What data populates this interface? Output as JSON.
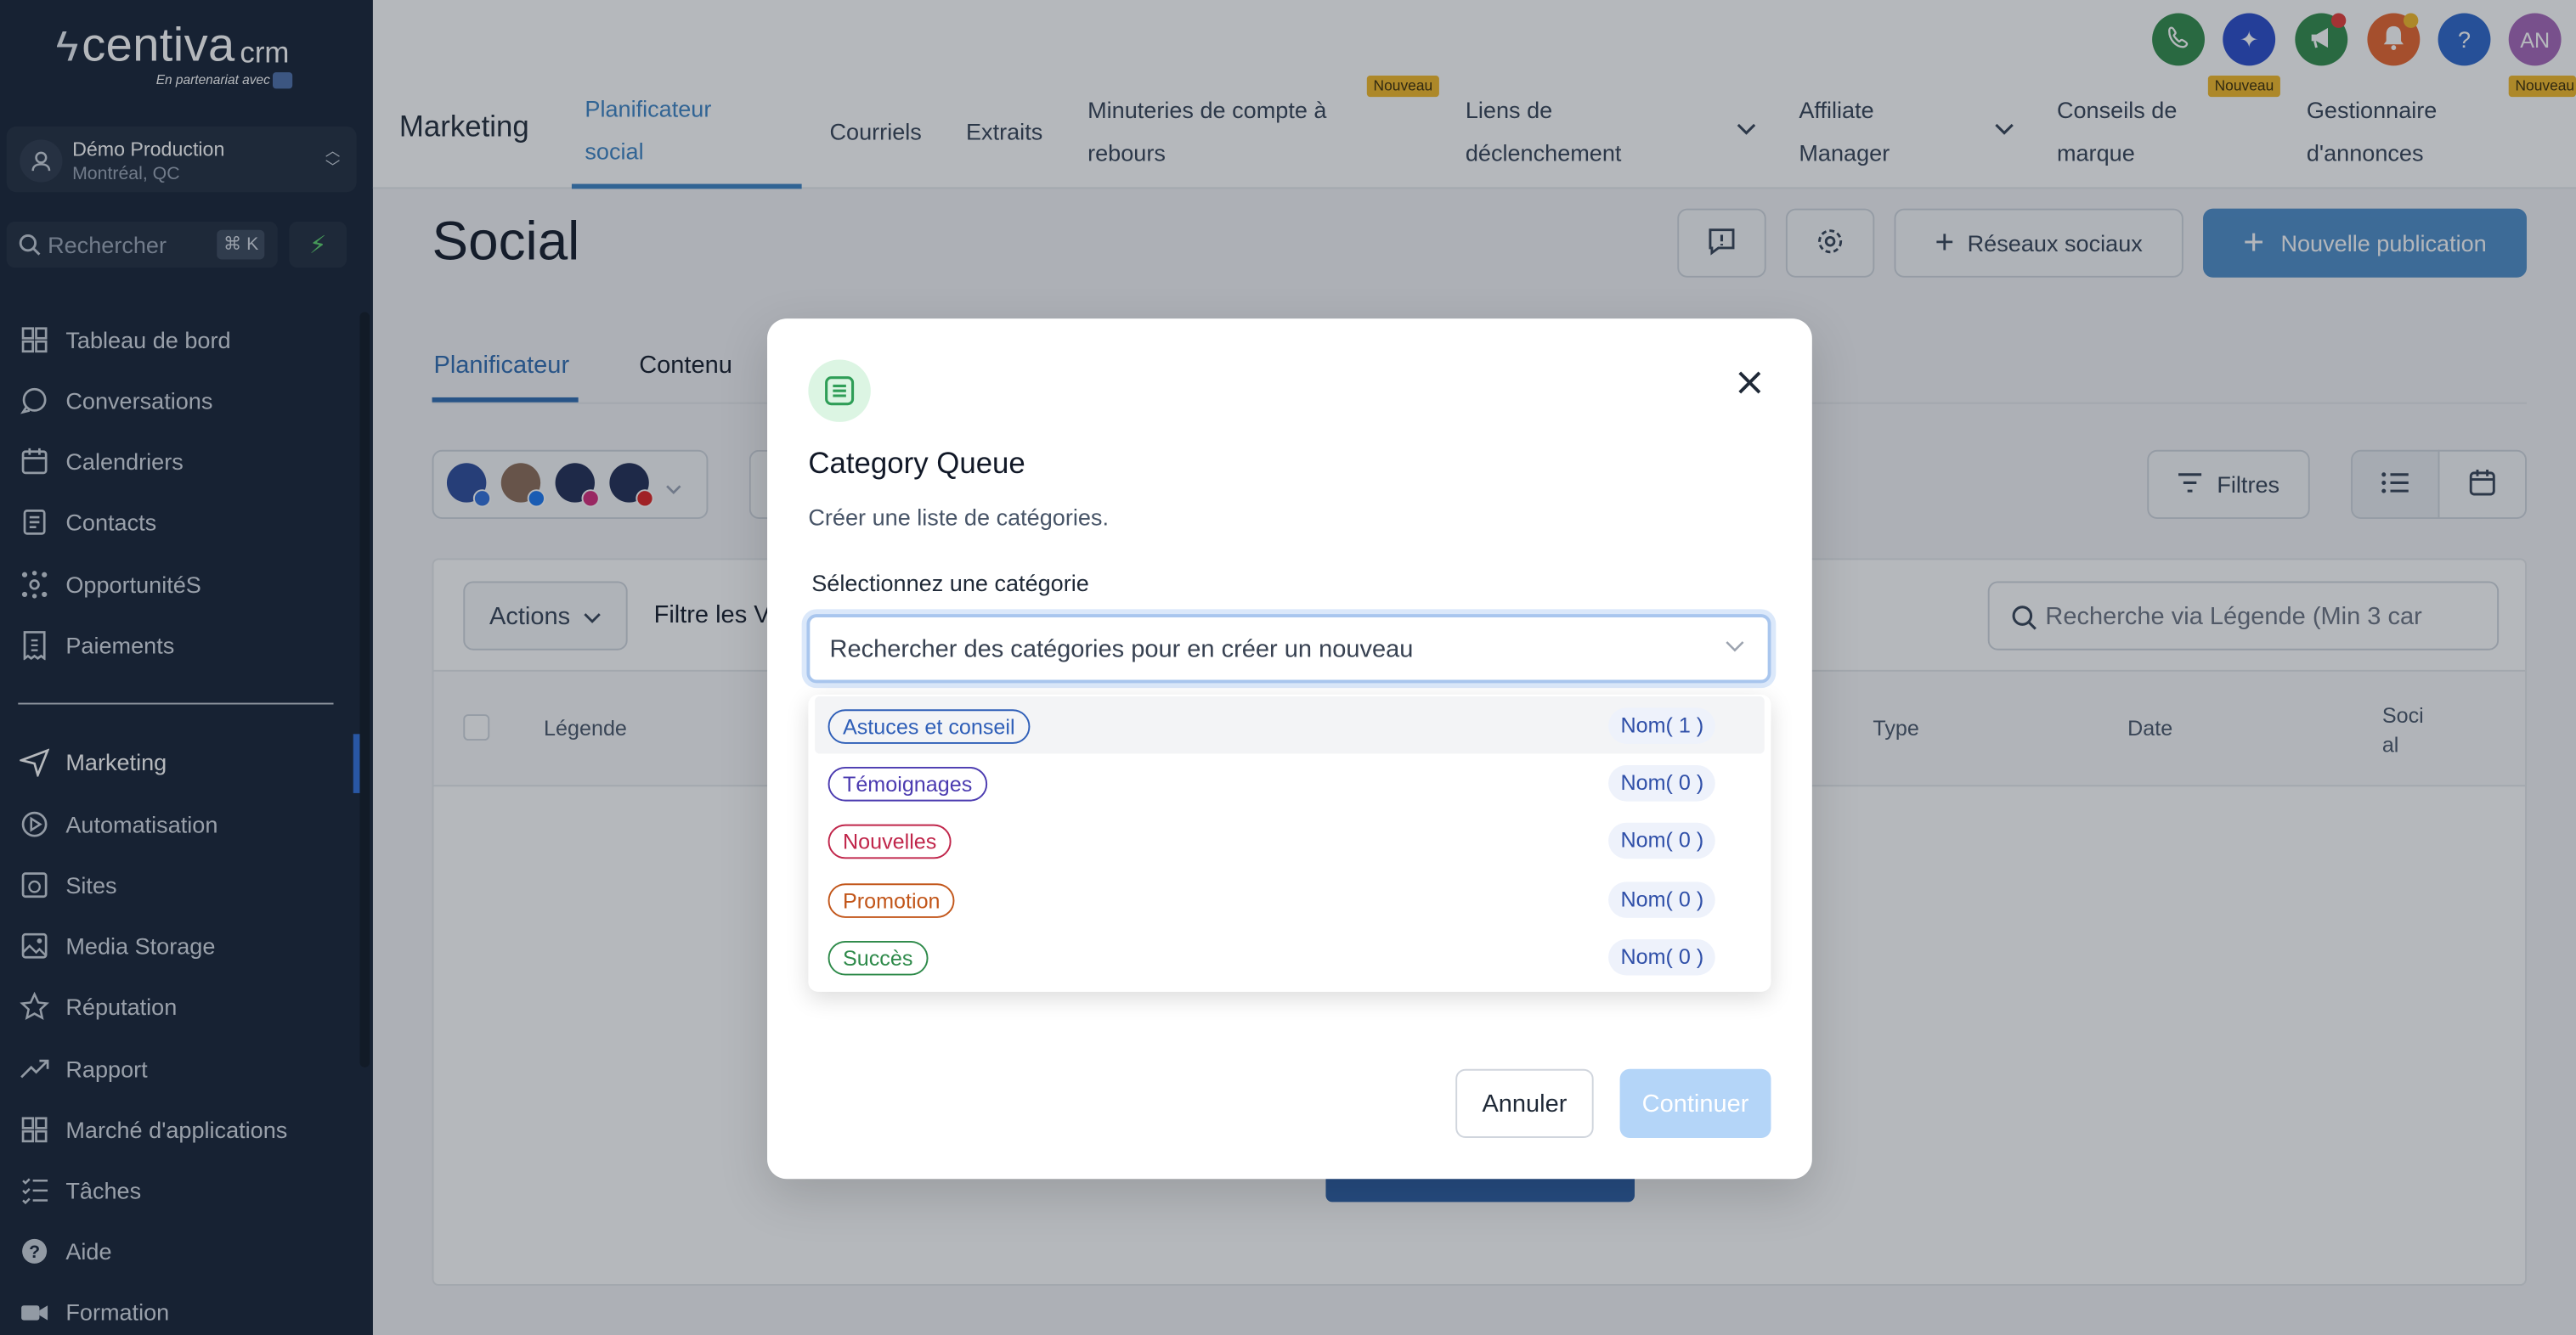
{
  "sidebar": {
    "logo": {
      "word": "centiva",
      "suffix": "crm",
      "tagline": "En partenariat avec"
    },
    "location": {
      "name": "Démo Production",
      "city": "Montréal, QC"
    },
    "search": {
      "placeholder": "Rechercher",
      "shortcut": "⌘ K"
    },
    "items": [
      {
        "label": "Tableau de bord",
        "icon": "grid-icon"
      },
      {
        "label": "Conversations",
        "icon": "chat-icon"
      },
      {
        "label": "Calendriers",
        "icon": "calendar-icon"
      },
      {
        "label": "Contacts",
        "icon": "contacts-icon"
      },
      {
        "label": "OpportunitéS",
        "icon": "network-icon"
      },
      {
        "label": "Paiements",
        "icon": "receipt-icon"
      },
      {
        "label": "Marketing",
        "icon": "send-icon"
      },
      {
        "label": "Automatisation",
        "icon": "automation-icon"
      },
      {
        "label": "Sites",
        "icon": "globe-icon"
      },
      {
        "label": "Media Storage",
        "icon": "image-icon"
      },
      {
        "label": "Réputation",
        "icon": "star-icon"
      },
      {
        "label": "Rapport",
        "icon": "trend-icon"
      },
      {
        "label": "Marché d'applications",
        "icon": "apps-icon"
      },
      {
        "label": "Tâches",
        "icon": "tasks-icon"
      },
      {
        "label": "Aide",
        "icon": "help-icon"
      },
      {
        "label": "Formation",
        "icon": "video-icon"
      }
    ]
  },
  "topbar": {
    "section": "Marketing",
    "tabs": [
      {
        "l1": "Planificateur",
        "l2": "social"
      },
      {
        "l1": "Courriels",
        "l2": ""
      },
      {
        "l1": "Extraits",
        "l2": ""
      },
      {
        "l1": "Minuteries de compte à",
        "l2": "rebours"
      },
      {
        "l1": "Liens de",
        "l2": "déclenchement"
      },
      {
        "l1": "Affiliate",
        "l2": "Manager"
      },
      {
        "l1": "Conseils de",
        "l2": "marque"
      },
      {
        "l1": "Gestionnaire",
        "l2": "d'annonces"
      }
    ],
    "badge_new": "Nouveau",
    "badge_new_cut": "Nouveau",
    "user_initials": "AN",
    "help_glyph": "?"
  },
  "page": {
    "title": "Social",
    "btn_social": "Réseaux sociaux",
    "btn_new": "Nouvelle publication",
    "subtabs": [
      "Planificateur",
      "Contenu"
    ],
    "filters": "Filtres",
    "actions": "Actions",
    "filter_label": "Filtre les V",
    "search_placeholder": "Recherche via Légende (Min 3 car",
    "columns": {
      "legende": "Légende",
      "type": "Type",
      "date": "Date",
      "social1": "Soci",
      "social2": "al"
    }
  },
  "modal": {
    "title": "Category Queue",
    "subtitle": "Créer une liste de catégories.",
    "label": "Sélectionnez une catégorie",
    "placeholder": "Rechercher des catégories pour en créer un nouveau",
    "options": [
      {
        "name": "Astuces et conseil",
        "count": "Nom( 1 )",
        "color": "#2f5fb8"
      },
      {
        "name": "Témoignages",
        "count": "Nom( 0 )",
        "color": "#4b3bb0"
      },
      {
        "name": "Nouvelles",
        "count": "Nom( 0 )",
        "color": "#c0254a"
      },
      {
        "name": "Promotion",
        "count": "Nom( 0 )",
        "color": "#c2561a"
      },
      {
        "name": "Succès",
        "count": "Nom( 0 )",
        "color": "#2e8a4a"
      }
    ],
    "cancel": "Annuler",
    "continue": "Continuer"
  },
  "colors": {
    "accent": "#3b82c4",
    "sidebar_bg": "#142033",
    "primary_btn": "#3b82c4"
  }
}
